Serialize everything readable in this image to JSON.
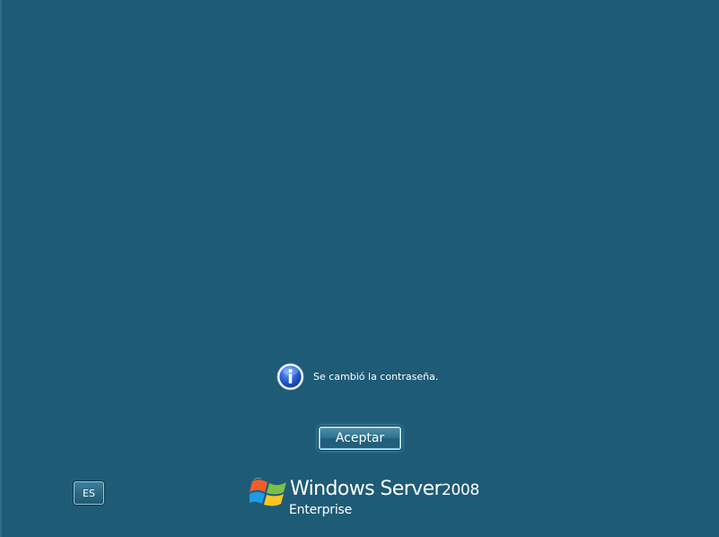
{
  "message": {
    "icon": "info-icon",
    "text": "Se cambió la contraseña."
  },
  "ok_button": {
    "label": "Aceptar"
  },
  "language_button": {
    "label": "ES"
  },
  "branding": {
    "windows": "Windows",
    "server": "Server",
    "year": "2008",
    "edition": "Enterprise",
    "logo_icon": "windows-flag-icon"
  },
  "colors": {
    "background": "#1e5b77",
    "text": "#ffffff",
    "button_glow": "#6fd8ff",
    "info_icon": "#1c56c4"
  }
}
